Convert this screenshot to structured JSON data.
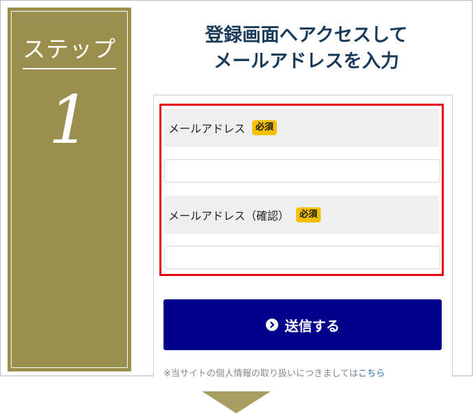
{
  "step": {
    "label": "ステップ",
    "number": "1"
  },
  "title": {
    "line1": "登録画面へアクセスして",
    "line2": "メールアドレスを入力"
  },
  "form": {
    "email_label": "メールアドレス",
    "email_required": "必須",
    "email_value": "",
    "email_confirm_label": "メールアドレス（確認）",
    "email_confirm_required": "必須",
    "email_confirm_value": "",
    "submit_label": "送信する",
    "submit_icon": "chevron-circle-right-icon"
  },
  "notice": {
    "text": "※当サイトの個人情報の取り扱いにつきましては",
    "link": "こちら"
  },
  "colors": {
    "step_panel": "#9b8f4e",
    "title": "#1a3a5a",
    "required_badge": "#f5c000",
    "highlight_border": "#e60012",
    "submit_button": "#00008b",
    "arrow": "#a79e62"
  }
}
